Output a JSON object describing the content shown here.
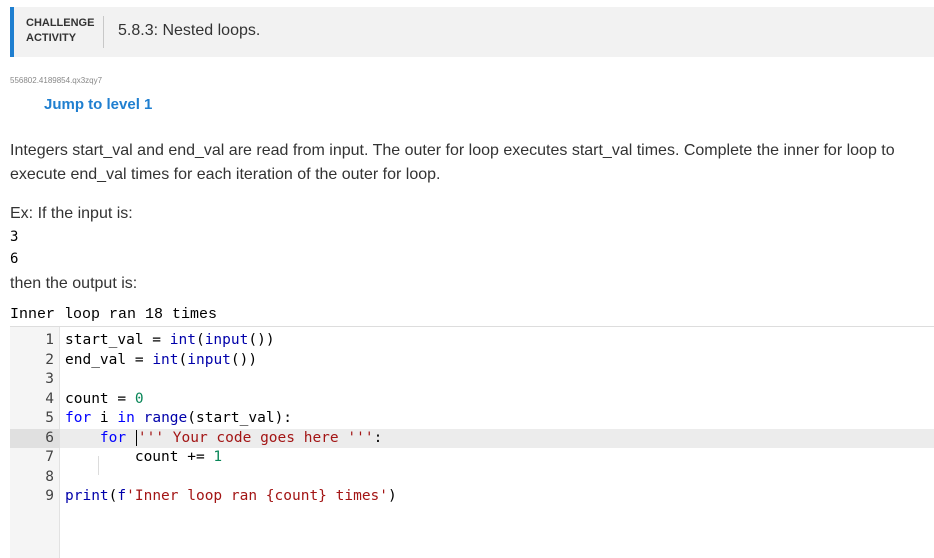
{
  "header": {
    "label_line1": "CHALLENGE",
    "label_line2": "ACTIVITY",
    "title": "5.8.3: Nested loops."
  },
  "activity_id": "556802.4189854.qx3zqy7",
  "jump_link": "Jump to level 1",
  "prompt": "Integers start_val and end_val are read from input. The outer for loop executes start_val times. Complete the inner for loop to execute end_val times for each iteration of the outer for loop.",
  "example_intro": "Ex: If the input is:",
  "example_inputs": [
    "3",
    "6"
  ],
  "then_text": "then the output is:",
  "example_output": "Inner loop ran 18 times",
  "code": {
    "active_line": 6,
    "lines": [
      {
        "n": "1",
        "t": "start_val = int(input())"
      },
      {
        "n": "2",
        "t": "end_val = int(input())"
      },
      {
        "n": "3",
        "t": ""
      },
      {
        "n": "4",
        "t": "count = 0"
      },
      {
        "n": "5",
        "t": "for i in range(start_val):"
      },
      {
        "n": "6",
        "t": "    for ''' Your code goes here ''':"
      },
      {
        "n": "7",
        "t": "        count += 1"
      },
      {
        "n": "8",
        "t": ""
      },
      {
        "n": "9",
        "t": "print(f'Inner loop ran {count} times')"
      }
    ]
  },
  "colors": {
    "accent": "#1f7fd0",
    "keyword": "#0000ff",
    "string": "#a31515",
    "number": "#098658"
  }
}
